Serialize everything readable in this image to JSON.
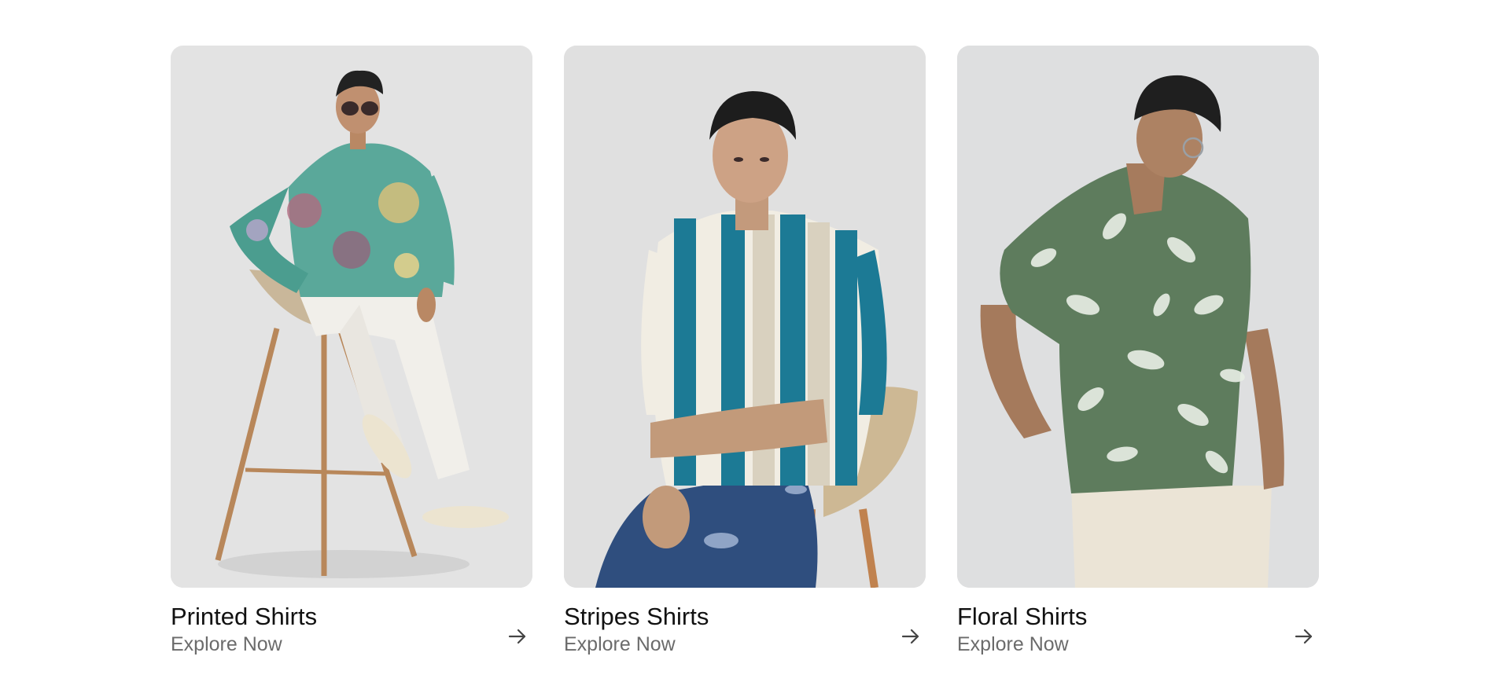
{
  "categories": [
    {
      "title": "Printed Shirts",
      "cta": "Explore Now",
      "icon": "arrow-right-icon",
      "image": "model-printed-shirt"
    },
    {
      "title": "Stripes Shirts",
      "cta": "Explore Now",
      "icon": "arrow-right-icon",
      "image": "model-stripes-shirt"
    },
    {
      "title": "Floral Shirts",
      "cta": "Explore Now",
      "icon": "arrow-right-icon",
      "image": "model-floral-shirt"
    }
  ]
}
